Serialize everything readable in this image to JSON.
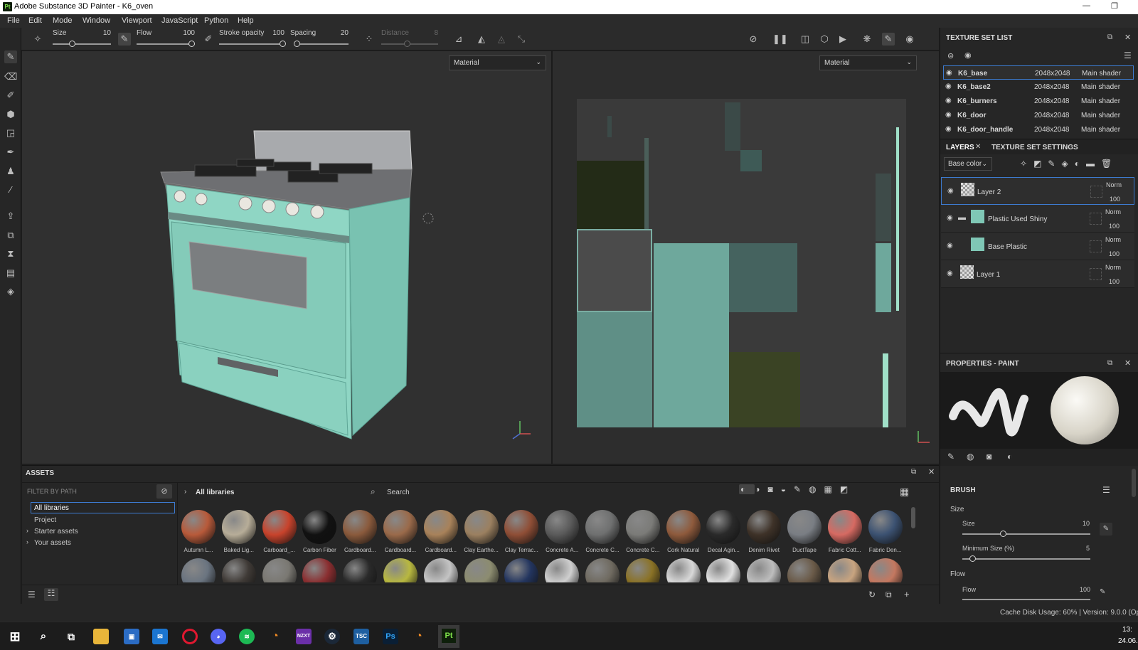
{
  "window": {
    "title": "Adobe Substance 3D Painter - K6_oven",
    "app_badge": "Pt"
  },
  "menu": [
    "File",
    "Edit",
    "Mode",
    "Window",
    "Viewport",
    "JavaScript",
    "Python",
    "Help"
  ],
  "toolbar": {
    "size_label": "Size",
    "size_value": "10",
    "flow_label": "Flow",
    "flow_value": "100",
    "stroke_opacity_label": "Stroke opacity",
    "stroke_opacity_value": "100",
    "spacing_label": "Spacing",
    "spacing_value": "20",
    "distance_label": "Distance",
    "distance_value": "8"
  },
  "viewport3d": {
    "mode": "Material"
  },
  "viewport2d": {
    "mode": "Material"
  },
  "texture_set_list": {
    "title": "TEXTURE SET LIST",
    "rows": [
      {
        "name": "K6_base",
        "resolution": "2048x2048",
        "shader": "Main shader"
      },
      {
        "name": "K6_base2",
        "resolution": "2048x2048",
        "shader": "Main shader"
      },
      {
        "name": "K6_burners",
        "resolution": "2048x2048",
        "shader": "Main shader"
      },
      {
        "name": "K6_door",
        "resolution": "2048x2048",
        "shader": "Main shader"
      },
      {
        "name": "K6_door_handle",
        "resolution": "2048x2048",
        "shader": "Main shader"
      }
    ]
  },
  "layers": {
    "tab_layers": "LAYERS",
    "tab_settings": "TEXTURE SET SETTINGS",
    "channel": "Base color",
    "rows": [
      {
        "name": "Layer 2",
        "blend": "Norm",
        "opacity": "100"
      },
      {
        "name": "Plastic Used Shiny",
        "blend": "Norm",
        "opacity": "100"
      },
      {
        "name": "Base Plastic",
        "blend": "Norm",
        "opacity": "100"
      },
      {
        "name": "Layer 1",
        "blend": "Norm",
        "opacity": "100"
      }
    ]
  },
  "properties": {
    "title": "PROPERTIES - PAINT",
    "brush_header": "BRUSH",
    "size_section": "Size",
    "size_label": "Size",
    "size_value": "10",
    "min_size_label": "Minimum Size (%)",
    "min_size_value": "5",
    "flow_section": "Flow",
    "flow_label": "Flow",
    "flow_value": "100"
  },
  "assets": {
    "title": "ASSETS",
    "filter_placeholder": "FILTER BY PATH",
    "tree": [
      "All libraries",
      "Project",
      "Starter assets",
      "Your assets"
    ],
    "breadcrumb": "All libraries",
    "search_placeholder": "Search",
    "items_row1": [
      "Autumn L...",
      "Baked Lig...",
      "Carboard_...",
      "Carbon Fiber",
      "Cardboard...",
      "Cardboard...",
      "Cardboard...",
      "Clay Earthe...",
      "Clay Terrac...",
      "Concrete A...",
      "Concrete C...",
      "Concrete C...",
      "Cork Natural",
      "Decal Agin...",
      "Denim Rivet",
      "DuctTape",
      "Fabric Cott...",
      "Fabric Den..."
    ],
    "colors_row1": [
      "#b85a3a",
      "#b7ad98",
      "#c8432c",
      "#111111",
      "#8a5a3c",
      "#9a6a4a",
      "#a8825a",
      "#9b8060",
      "#8f4e36",
      "#5a5a5a",
      "#6f7070",
      "#7b7b78",
      "#8e5a3c",
      "#2a2a2a",
      "#3e3228",
      "#7a7e84",
      "#d66a62",
      "#3c5272"
    ],
    "colors_row2": [
      "#6a7480",
      "#3f3a36",
      "#7a7872",
      "#8a2e30",
      "#2a2a2a",
      "#b8b840",
      "#c4c4c4",
      "#8c8c70",
      "#23355f",
      "#cfcfcf",
      "#6f6a60",
      "#8a7226",
      "#d8d8d8",
      "#e0e0e0",
      "#bdbdbd",
      "#6a5a48",
      "#c8a480",
      "#c47860"
    ]
  },
  "status": {
    "text": "Cache Disk Usage:   60% | Version: 9.0.0 (Oper",
    "clock_time": "13:",
    "clock_date": "24.06."
  },
  "taskbar": [
    "start",
    "search",
    "taskview",
    "explorer",
    "store",
    "mail",
    "opera",
    "discord",
    "spotify",
    "blender",
    "nzxt",
    "steam",
    "tbc",
    "photoshop",
    "blender2",
    "painter"
  ]
}
